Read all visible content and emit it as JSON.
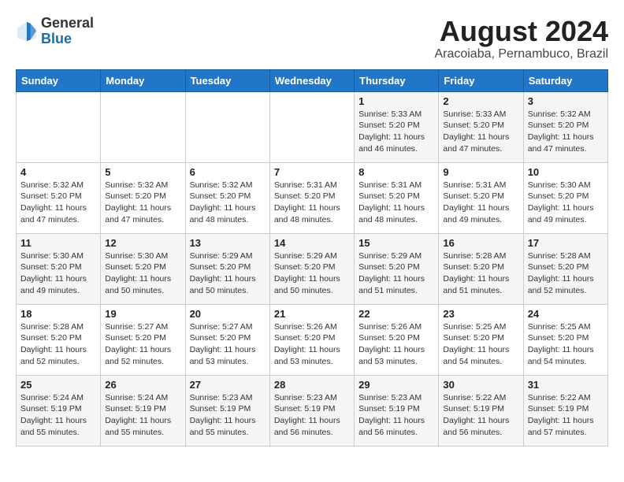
{
  "header": {
    "logo_general": "General",
    "logo_blue": "Blue",
    "month_year": "August 2024",
    "location": "Aracoiaba, Pernambuco, Brazil"
  },
  "weekdays": [
    "Sunday",
    "Monday",
    "Tuesday",
    "Wednesday",
    "Thursday",
    "Friday",
    "Saturday"
  ],
  "weeks": [
    [
      {
        "day": "",
        "info": ""
      },
      {
        "day": "",
        "info": ""
      },
      {
        "day": "",
        "info": ""
      },
      {
        "day": "",
        "info": ""
      },
      {
        "day": "1",
        "info": "Sunrise: 5:33 AM\nSunset: 5:20 PM\nDaylight: 11 hours and 46 minutes."
      },
      {
        "day": "2",
        "info": "Sunrise: 5:33 AM\nSunset: 5:20 PM\nDaylight: 11 hours and 47 minutes."
      },
      {
        "day": "3",
        "info": "Sunrise: 5:32 AM\nSunset: 5:20 PM\nDaylight: 11 hours and 47 minutes."
      }
    ],
    [
      {
        "day": "4",
        "info": "Sunrise: 5:32 AM\nSunset: 5:20 PM\nDaylight: 11 hours and 47 minutes."
      },
      {
        "day": "5",
        "info": "Sunrise: 5:32 AM\nSunset: 5:20 PM\nDaylight: 11 hours and 47 minutes."
      },
      {
        "day": "6",
        "info": "Sunrise: 5:32 AM\nSunset: 5:20 PM\nDaylight: 11 hours and 48 minutes."
      },
      {
        "day": "7",
        "info": "Sunrise: 5:31 AM\nSunset: 5:20 PM\nDaylight: 11 hours and 48 minutes."
      },
      {
        "day": "8",
        "info": "Sunrise: 5:31 AM\nSunset: 5:20 PM\nDaylight: 11 hours and 48 minutes."
      },
      {
        "day": "9",
        "info": "Sunrise: 5:31 AM\nSunset: 5:20 PM\nDaylight: 11 hours and 49 minutes."
      },
      {
        "day": "10",
        "info": "Sunrise: 5:30 AM\nSunset: 5:20 PM\nDaylight: 11 hours and 49 minutes."
      }
    ],
    [
      {
        "day": "11",
        "info": "Sunrise: 5:30 AM\nSunset: 5:20 PM\nDaylight: 11 hours and 49 minutes."
      },
      {
        "day": "12",
        "info": "Sunrise: 5:30 AM\nSunset: 5:20 PM\nDaylight: 11 hours and 50 minutes."
      },
      {
        "day": "13",
        "info": "Sunrise: 5:29 AM\nSunset: 5:20 PM\nDaylight: 11 hours and 50 minutes."
      },
      {
        "day": "14",
        "info": "Sunrise: 5:29 AM\nSunset: 5:20 PM\nDaylight: 11 hours and 50 minutes."
      },
      {
        "day": "15",
        "info": "Sunrise: 5:29 AM\nSunset: 5:20 PM\nDaylight: 11 hours and 51 minutes."
      },
      {
        "day": "16",
        "info": "Sunrise: 5:28 AM\nSunset: 5:20 PM\nDaylight: 11 hours and 51 minutes."
      },
      {
        "day": "17",
        "info": "Sunrise: 5:28 AM\nSunset: 5:20 PM\nDaylight: 11 hours and 52 minutes."
      }
    ],
    [
      {
        "day": "18",
        "info": "Sunrise: 5:28 AM\nSunset: 5:20 PM\nDaylight: 11 hours and 52 minutes."
      },
      {
        "day": "19",
        "info": "Sunrise: 5:27 AM\nSunset: 5:20 PM\nDaylight: 11 hours and 52 minutes."
      },
      {
        "day": "20",
        "info": "Sunrise: 5:27 AM\nSunset: 5:20 PM\nDaylight: 11 hours and 53 minutes."
      },
      {
        "day": "21",
        "info": "Sunrise: 5:26 AM\nSunset: 5:20 PM\nDaylight: 11 hours and 53 minutes."
      },
      {
        "day": "22",
        "info": "Sunrise: 5:26 AM\nSunset: 5:20 PM\nDaylight: 11 hours and 53 minutes."
      },
      {
        "day": "23",
        "info": "Sunrise: 5:25 AM\nSunset: 5:20 PM\nDaylight: 11 hours and 54 minutes."
      },
      {
        "day": "24",
        "info": "Sunrise: 5:25 AM\nSunset: 5:20 PM\nDaylight: 11 hours and 54 minutes."
      }
    ],
    [
      {
        "day": "25",
        "info": "Sunrise: 5:24 AM\nSunset: 5:19 PM\nDaylight: 11 hours and 55 minutes."
      },
      {
        "day": "26",
        "info": "Sunrise: 5:24 AM\nSunset: 5:19 PM\nDaylight: 11 hours and 55 minutes."
      },
      {
        "day": "27",
        "info": "Sunrise: 5:23 AM\nSunset: 5:19 PM\nDaylight: 11 hours and 55 minutes."
      },
      {
        "day": "28",
        "info": "Sunrise: 5:23 AM\nSunset: 5:19 PM\nDaylight: 11 hours and 56 minutes."
      },
      {
        "day": "29",
        "info": "Sunrise: 5:23 AM\nSunset: 5:19 PM\nDaylight: 11 hours and 56 minutes."
      },
      {
        "day": "30",
        "info": "Sunrise: 5:22 AM\nSunset: 5:19 PM\nDaylight: 11 hours and 56 minutes."
      },
      {
        "day": "31",
        "info": "Sunrise: 5:22 AM\nSunset: 5:19 PM\nDaylight: 11 hours and 57 minutes."
      }
    ]
  ]
}
